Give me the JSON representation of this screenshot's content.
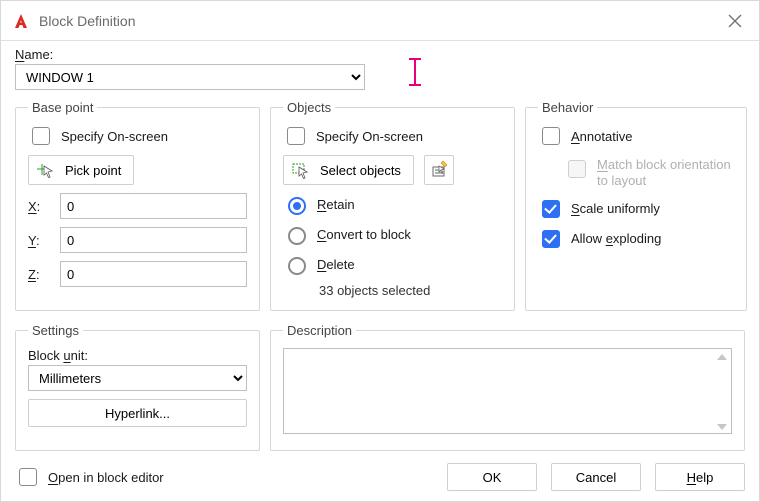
{
  "window": {
    "title": "Block Definition"
  },
  "name_section": {
    "label_pre": "",
    "label_u": "N",
    "label_post": "ame:",
    "value": "WINDOW 1"
  },
  "basepoint": {
    "legend": "Base point",
    "specify_label": "Specify On-screen",
    "specify_checked": false,
    "pick_point_label": "Pick point",
    "x_pre": "",
    "x_u": "X",
    "x_post": ":",
    "x_val": "0",
    "y_pre": "",
    "y_u": "Y",
    "y_post": ":",
    "y_val": "0",
    "z_pre": "",
    "z_u": "Z",
    "z_post": ":",
    "z_val": "0"
  },
  "objects": {
    "legend": "Objects",
    "specify_label": "Specify On-screen",
    "specify_checked": false,
    "select_label": "Select objects",
    "retain_pre": "",
    "retain_u": "R",
    "retain_post": "etain",
    "convert_pre": "",
    "convert_u": "C",
    "convert_post": "onvert to block",
    "delete_pre": "",
    "delete_u": "D",
    "delete_post": "elete",
    "mode": "retain",
    "status": "33 objects selected"
  },
  "behavior": {
    "legend": "Behavior",
    "annotative_pre": "",
    "annotative_u": "A",
    "annotative_post": "nnotative",
    "annotative_checked": false,
    "match_pre": "",
    "match_u": "M",
    "match_post": "atch block orientation",
    "match_line2": "to layout",
    "match_checked": false,
    "scale_pre": "",
    "scale_u": "S",
    "scale_post": "cale uniformly",
    "scale_checked": true,
    "explode_pre": "Allow ",
    "explode_u": "e",
    "explode_post": "xploding",
    "explode_checked": true
  },
  "settings": {
    "legend": "Settings",
    "block_unit_pre": "Block ",
    "block_unit_u": "u",
    "block_unit_post": "nit:",
    "block_unit_value": "Millimeters",
    "hyperlink_label": "Hyperlink..."
  },
  "description": {
    "legend": "Description",
    "value": ""
  },
  "footer": {
    "open_pre": "",
    "open_u": "O",
    "open_post": "pen in block editor",
    "open_checked": false,
    "ok": "OK",
    "cancel": "Cancel",
    "help_pre": "",
    "help_u": "H",
    "help_post": "elp"
  }
}
